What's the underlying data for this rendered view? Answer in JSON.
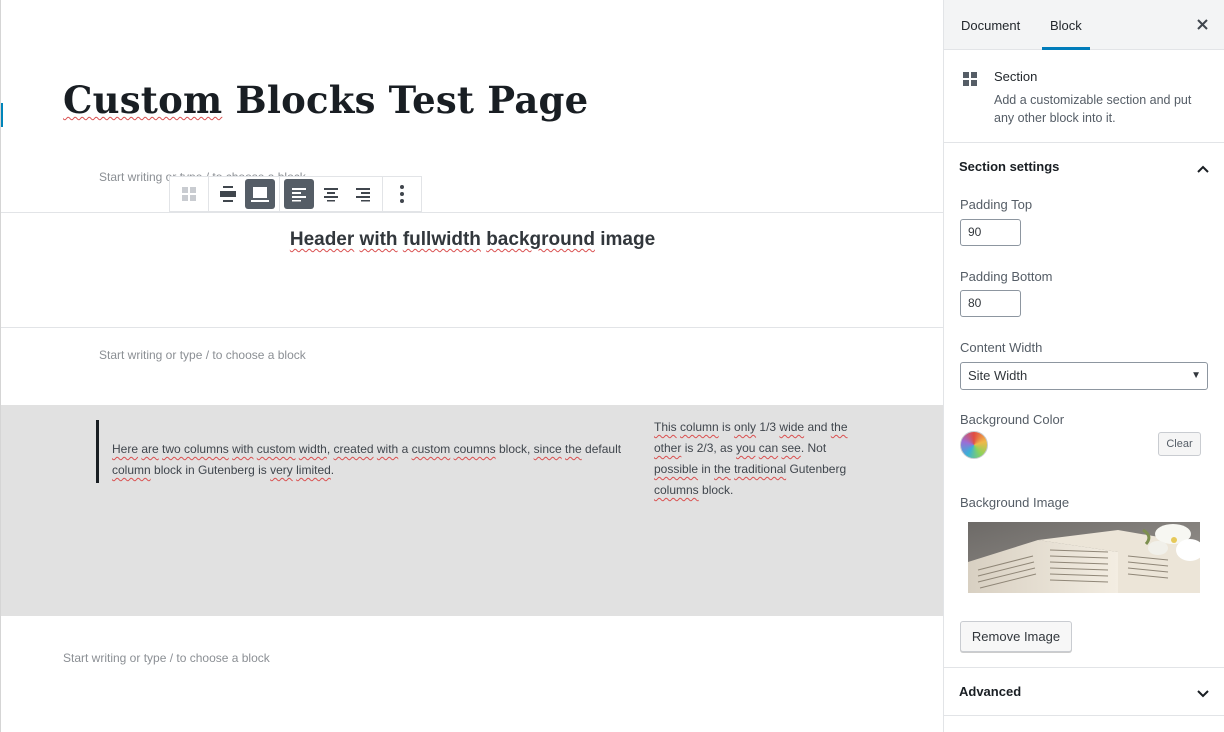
{
  "editor": {
    "title": "Custom Blocks Test Page",
    "title_misspelled": "Custom",
    "title_rest": " Blocks Test Page",
    "placeholder_1": "Start writing or type / to choose a block",
    "placeholder_2": "Start writing or type / to choose a block",
    "placeholder_3": "Start writing or type / to choose a block",
    "header_block": {
      "w1": "Header",
      "w2": "with",
      "w3": "fullwidth",
      "w4": "background",
      "w5": "image"
    },
    "columns": {
      "left": {
        "t1": "Here",
        "t2": "are",
        "t3": "two columns",
        "t4": "with",
        "t5": "custom",
        "t6": "width",
        "t7": ",",
        "t8": "created",
        "t9": "with",
        "t10": " a ",
        "t11": "custom",
        "t12": "coumns",
        "t13": " block, ",
        "t14": "since",
        "t15": "the",
        "t16": " default ",
        "t17": "column",
        "t18": " block in Gutenberg is ",
        "t19": "very",
        "t20": "limited",
        "t21": "."
      },
      "right": {
        "t1": "This",
        "t2": "column",
        "t3": " is ",
        "t4": "only",
        "t5": " 1/3 ",
        "t6": "wide",
        "t7": " and ",
        "t8": "the",
        "t9": "other",
        "t10": " is 2/3, as ",
        "t11": "you",
        "t12": "can",
        "t13": "see",
        "t14": ". Not",
        "t15": "possible",
        "t16": " in ",
        "t17": "the",
        "t18": "traditional",
        "t19": " Gutenberg",
        "t20": "columns",
        "t21": " block."
      }
    }
  },
  "sidebar": {
    "tabs": {
      "document": "Document",
      "block": "Block"
    },
    "block_card": {
      "title": "Section",
      "description": "Add a customizable section and put any other block into it."
    },
    "section_settings": {
      "title": "Section settings",
      "padding_top_label": "Padding Top",
      "padding_top_value": "90",
      "padding_bottom_label": "Padding Bottom",
      "padding_bottom_value": "80",
      "content_width_label": "Content Width",
      "content_width_value": "Site Width",
      "background_color_label": "Background Color",
      "clear_label": "Clear",
      "background_image_label": "Background Image",
      "remove_image_label": "Remove Image"
    },
    "advanced": {
      "title": "Advanced"
    }
  },
  "colors": {
    "accent": "#007cba",
    "grey_section": "#e1e1e1",
    "toolbar_active": "#555d66",
    "spellcheck": "#d94f4f"
  },
  "icons": {
    "block_icon": "grid-icon",
    "close": "close-icon",
    "chevron_up": "chevron-up-icon",
    "chevron_down": "chevron-down-icon"
  }
}
